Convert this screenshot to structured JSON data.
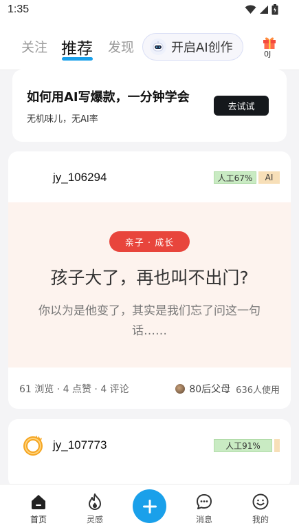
{
  "status_bar": {
    "time": "1:35"
  },
  "top_nav": {
    "tabs": [
      {
        "label": "关注",
        "active": false
      },
      {
        "label": "推荐",
        "active": true
      },
      {
        "label": "发现",
        "active": false
      }
    ],
    "ai_create_label": "开启AI创作",
    "gift_count": "0J"
  },
  "promo": {
    "title": "如何用AI写爆款，一分钟学会",
    "subtitle": "无机味儿，无AI率",
    "button_label": "去试试"
  },
  "posts": [
    {
      "username": "jy_106294",
      "human_badge": "人工67%",
      "ai_badge": "AI",
      "tag": "亲子 · 成长",
      "title": "孩子大了，再也叫不出门?",
      "description": "你以为是他变了，其实是我们忘了问这一句话……",
      "stats": "61 浏览 · 4 点赞 · 4 评论",
      "template_name": "80后父母",
      "template_usage": "636人使用"
    },
    {
      "username": "jy_107773",
      "human_badge": "人工91%"
    }
  ],
  "bottom_nav": {
    "items": [
      {
        "label": "首页",
        "icon": "home-icon",
        "active": true
      },
      {
        "label": "灵感",
        "icon": "flame-icon",
        "active": false
      },
      {
        "label": "消息",
        "icon": "message-icon",
        "active": false
      },
      {
        "label": "我的",
        "icon": "smile-icon",
        "active": false
      }
    ]
  },
  "colors": {
    "accent": "#1aa0ea",
    "tag_red": "#e8453c",
    "post_body_bg": "#fdf3ee",
    "human_badge_bg": "#c9ebc3",
    "ai_badge_bg": "#f7dfb8"
  }
}
